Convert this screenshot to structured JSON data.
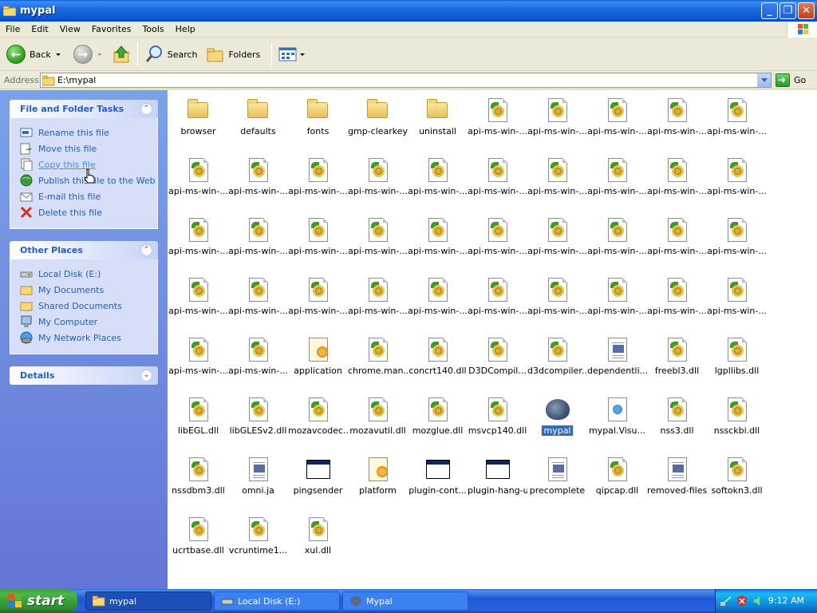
{
  "window": {
    "title": "mypal",
    "buttons": {
      "minimize": "_",
      "maximize": "❐",
      "close": "✕"
    }
  },
  "menu": [
    "File",
    "Edit",
    "View",
    "Favorites",
    "Tools",
    "Help"
  ],
  "toolbar": {
    "back_label": "Back",
    "search_label": "Search",
    "folders_label": "Folders"
  },
  "address": {
    "label": "Address",
    "value": "E:\\mypal",
    "go_label": "Go"
  },
  "tasks_panel": {
    "title": "File and Folder Tasks",
    "items": [
      {
        "label": "Rename this file",
        "icon": "rename-icon"
      },
      {
        "label": "Move this file",
        "icon": "move-icon"
      },
      {
        "label": "Copy this file",
        "icon": "copy-icon"
      },
      {
        "label": "Publish this file to the Web",
        "icon": "publish-icon"
      },
      {
        "label": "E-mail this file",
        "icon": "email-icon"
      },
      {
        "label": "Delete this file",
        "icon": "delete-icon"
      }
    ]
  },
  "places_panel": {
    "title": "Other Places",
    "items": [
      {
        "label": "Local Disk (E:)",
        "icon": "drive-icon"
      },
      {
        "label": "My Documents",
        "icon": "folder-icon"
      },
      {
        "label": "Shared Documents",
        "icon": "folder-icon"
      },
      {
        "label": "My Computer",
        "icon": "computer-icon"
      },
      {
        "label": "My Network Places",
        "icon": "network-icon"
      }
    ]
  },
  "details_panel": {
    "title": "Details"
  },
  "files": [
    {
      "name": "browser",
      "type": "folder"
    },
    {
      "name": "defaults",
      "type": "folder"
    },
    {
      "name": "fonts",
      "type": "folder"
    },
    {
      "name": "gmp-clearkey",
      "type": "folder"
    },
    {
      "name": "uninstall",
      "type": "folder"
    },
    {
      "name": "api-ms-win-...",
      "type": "dll"
    },
    {
      "name": "api-ms-win-...",
      "type": "dll"
    },
    {
      "name": "api-ms-win-...",
      "type": "dll"
    },
    {
      "name": "api-ms-win-...",
      "type": "dll"
    },
    {
      "name": "api-ms-win-...",
      "type": "dll"
    },
    {
      "name": "api-ms-win-...",
      "type": "dll"
    },
    {
      "name": "api-ms-win-...",
      "type": "dll"
    },
    {
      "name": "api-ms-win-...",
      "type": "dll"
    },
    {
      "name": "api-ms-win-...",
      "type": "dll"
    },
    {
      "name": "api-ms-win-...",
      "type": "dll"
    },
    {
      "name": "api-ms-win-...",
      "type": "dll"
    },
    {
      "name": "api-ms-win-...",
      "type": "dll"
    },
    {
      "name": "api-ms-win-...",
      "type": "dll"
    },
    {
      "name": "api-ms-win-...",
      "type": "dll"
    },
    {
      "name": "api-ms-win-...",
      "type": "dll"
    },
    {
      "name": "api-ms-win-...",
      "type": "dll"
    },
    {
      "name": "api-ms-win-...",
      "type": "dll"
    },
    {
      "name": "api-ms-win-...",
      "type": "dll"
    },
    {
      "name": "api-ms-win-...",
      "type": "dll"
    },
    {
      "name": "api-ms-win-...",
      "type": "dll"
    },
    {
      "name": "api-ms-win-...",
      "type": "dll"
    },
    {
      "name": "api-ms-win-...",
      "type": "dll"
    },
    {
      "name": "api-ms-win-...",
      "type": "dll"
    },
    {
      "name": "api-ms-win-...",
      "type": "dll"
    },
    {
      "name": "api-ms-win-...",
      "type": "dll"
    },
    {
      "name": "api-ms-win-...",
      "type": "dll"
    },
    {
      "name": "api-ms-win-...",
      "type": "dll"
    },
    {
      "name": "api-ms-win-...",
      "type": "dll"
    },
    {
      "name": "api-ms-win-...",
      "type": "dll"
    },
    {
      "name": "api-ms-win-...",
      "type": "dll"
    },
    {
      "name": "api-ms-win-...",
      "type": "dll"
    },
    {
      "name": "api-ms-win-...",
      "type": "dll"
    },
    {
      "name": "api-ms-win-...",
      "type": "dll"
    },
    {
      "name": "api-ms-win-...",
      "type": "dll"
    },
    {
      "name": "api-ms-win-...",
      "type": "dll"
    },
    {
      "name": "api-ms-win-...",
      "type": "dll"
    },
    {
      "name": "api-ms-win-...",
      "type": "dll"
    },
    {
      "name": "application",
      "type": "app"
    },
    {
      "name": "chrome.man...",
      "type": "dll"
    },
    {
      "name": "concrt140.dll",
      "type": "dll"
    },
    {
      "name": "D3DCompil...",
      "type": "dll"
    },
    {
      "name": "d3dcompiler...",
      "type": "dll"
    },
    {
      "name": "dependentli...",
      "type": "doc"
    },
    {
      "name": "freebl3.dll",
      "type": "dll"
    },
    {
      "name": "lgpllibs.dll",
      "type": "dll"
    },
    {
      "name": "libEGL.dll",
      "type": "dll"
    },
    {
      "name": "libGLESv2.dll",
      "type": "dll"
    },
    {
      "name": "mozavcodec...",
      "type": "dll"
    },
    {
      "name": "mozavutil.dll",
      "type": "dll"
    },
    {
      "name": "mozglue.dll",
      "type": "dll"
    },
    {
      "name": "msvcp140.dll",
      "type": "dll"
    },
    {
      "name": "mypal",
      "type": "mypal",
      "selected": true
    },
    {
      "name": "mypal.Visu...",
      "type": "vis"
    },
    {
      "name": "nss3.dll",
      "type": "dll"
    },
    {
      "name": "nssckbi.dll",
      "type": "dll"
    },
    {
      "name": "nssdbm3.dll",
      "type": "dll"
    },
    {
      "name": "omni.ja",
      "type": "doc"
    },
    {
      "name": "pingsender",
      "type": "exe"
    },
    {
      "name": "platform",
      "type": "app"
    },
    {
      "name": "plugin-cont...",
      "type": "exe"
    },
    {
      "name": "plugin-hang-ui",
      "type": "exe"
    },
    {
      "name": "precomplete",
      "type": "doc"
    },
    {
      "name": "qipcap.dll",
      "type": "dll"
    },
    {
      "name": "removed-files",
      "type": "doc"
    },
    {
      "name": "softokn3.dll",
      "type": "dll"
    },
    {
      "name": "ucrtbase.dll",
      "type": "dll"
    },
    {
      "name": "vcruntime1...",
      "type": "dll"
    },
    {
      "name": "xul.dll",
      "type": "dll"
    }
  ],
  "taskbar": {
    "start_label": "start",
    "tasks": [
      {
        "label": "mypal",
        "active": true
      },
      {
        "label": "Local Disk (E:)",
        "active": false
      },
      {
        "label": "Mypal",
        "active": false
      }
    ],
    "clock": "9:12 AM"
  },
  "colors": {
    "title_bar": "#0A55D0",
    "left_pane": "#6F8FE0",
    "panel_link": "#215DC6",
    "selection": "#316AC5"
  }
}
